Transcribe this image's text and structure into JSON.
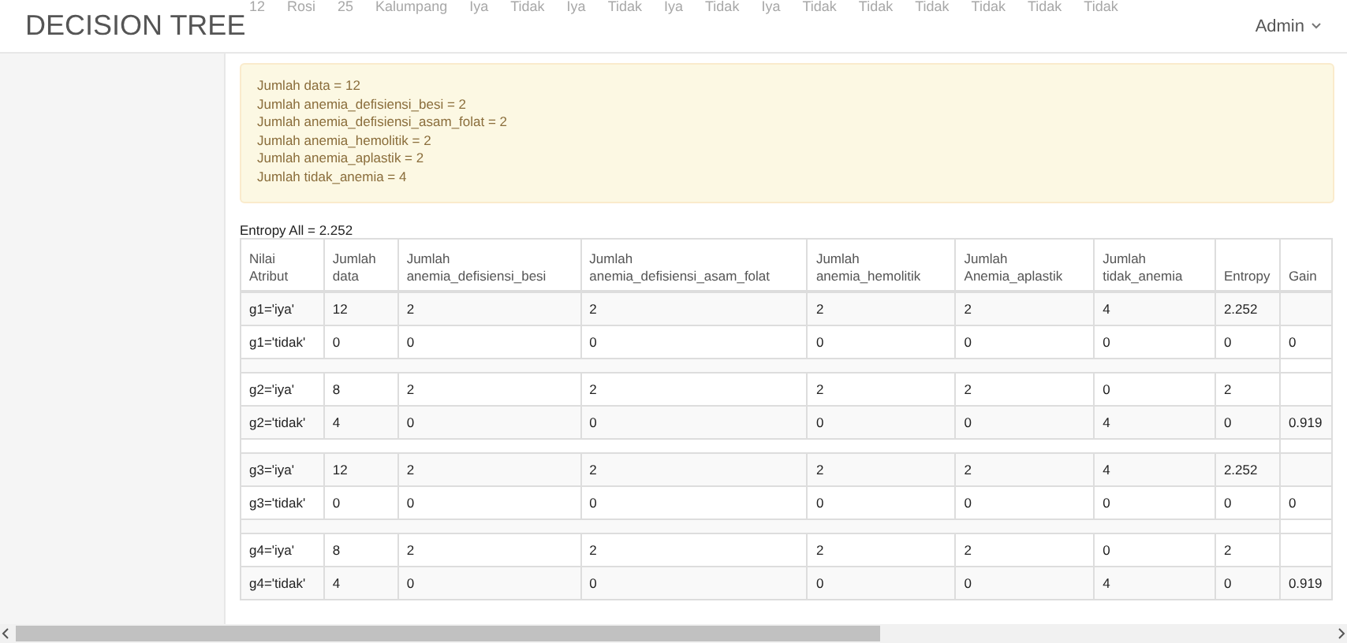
{
  "brand": "DECISION TREE",
  "user_menu": {
    "label": "Admin"
  },
  "background_row": [
    "12",
    "Rosi",
    "25",
    "Kalumpang",
    "Iya",
    "Tidak",
    "Iya",
    "Tidak",
    "Iya",
    "Tidak",
    "Iya",
    "Tidak",
    "Tidak",
    "Tidak",
    "Tidak",
    "Tidak",
    "Tidak"
  ],
  "summary": [
    "Jumlah data = 12",
    "Jumlah anemia_defisiensi_besi = 2",
    "Jumlah anemia_defisiensi_asam_folat = 2",
    "Jumlah anemia_hemolitik = 2",
    "Jumlah anemia_aplastik = 2",
    "Jumlah tidak_anemia = 4"
  ],
  "entropy_all": "Entropy All = 2.252",
  "table": {
    "columns": [
      [
        "Nilai",
        "Atribut"
      ],
      [
        "Jumlah",
        "data"
      ],
      [
        "Jumlah",
        "anemia_defisiensi_besi"
      ],
      [
        "Jumlah",
        "anemia_defisiensi_asam_folat"
      ],
      [
        "Jumlah",
        "anemia_hemolitik"
      ],
      [
        "Jumlah",
        "Anemia_aplastik"
      ],
      [
        "Jumlah",
        "tidak_anemia"
      ],
      [
        "Entropy"
      ],
      [
        "Gain"
      ]
    ],
    "groups": [
      {
        "rows": [
          {
            "label": "g1='iya'",
            "values": [
              "12",
              "2",
              "2",
              "2",
              "2",
              "4",
              "2.252"
            ]
          },
          {
            "label": "g1='tidak'",
            "values": [
              "0",
              "0",
              "0",
              "0",
              "0",
              "0",
              "0"
            ],
            "gain": "0"
          }
        ]
      },
      {
        "rows": [
          {
            "label": "g2='iya'",
            "values": [
              "8",
              "2",
              "2",
              "2",
              "2",
              "0",
              "2"
            ]
          },
          {
            "label": "g2='tidak'",
            "values": [
              "4",
              "0",
              "0",
              "0",
              "0",
              "4",
              "0"
            ],
            "gain": "0.919"
          }
        ]
      },
      {
        "rows": [
          {
            "label": "g3='iya'",
            "values": [
              "12",
              "2",
              "2",
              "2",
              "2",
              "4",
              "2.252"
            ]
          },
          {
            "label": "g3='tidak'",
            "values": [
              "0",
              "0",
              "0",
              "0",
              "0",
              "0",
              "0"
            ],
            "gain": "0"
          }
        ]
      },
      {
        "rows": [
          {
            "label": "g4='iya'",
            "values": [
              "8",
              "2",
              "2",
              "2",
              "2",
              "0",
              "2"
            ]
          },
          {
            "label": "g4='tidak'",
            "values": [
              "4",
              "0",
              "0",
              "0",
              "0",
              "4",
              "0"
            ],
            "gain": "0.919"
          }
        ]
      }
    ]
  }
}
